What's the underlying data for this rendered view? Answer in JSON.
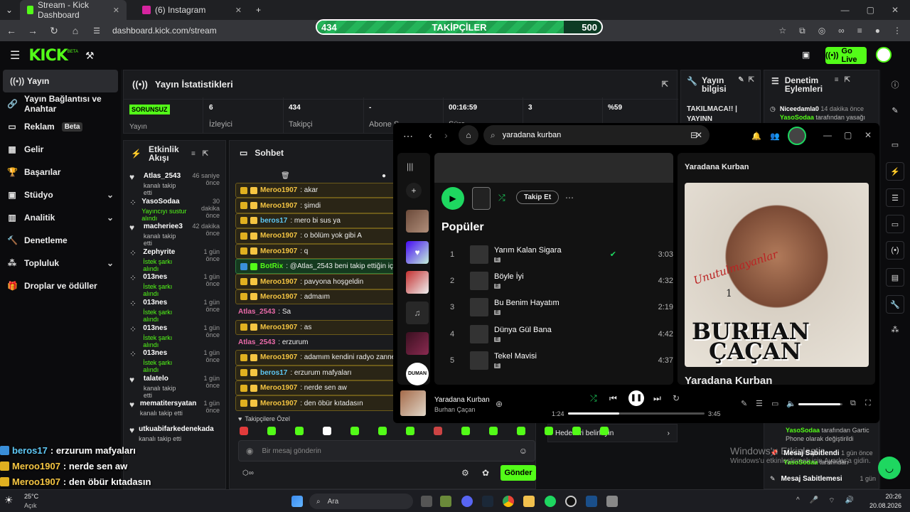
{
  "browser": {
    "tabs": [
      {
        "label": "Stream - Kick Dashboard",
        "color": "#53fc18"
      },
      {
        "label": "(6) Instagram",
        "color": "#d6249f"
      }
    ],
    "url": "dashboard.kick.com/stream",
    "follow_goal": {
      "label": "TAKİPÇİLER",
      "current": "434",
      "target": "500",
      "progress": 0.868
    }
  },
  "kick": {
    "logo": "KICK",
    "logo_sup": "BETA",
    "go_live": "Go Live",
    "nav": [
      {
        "label": "Yayın",
        "icon": "broadcast-icon",
        "active": true
      },
      {
        "label": "Yayın Bağlantısı ve Anahtar",
        "icon": "link-icon"
      },
      {
        "label": "Reklam",
        "icon": "ad-icon",
        "badge": "Beta"
      },
      {
        "label": "Gelir",
        "icon": "revenue-icon"
      },
      {
        "label": "Başarılar",
        "icon": "trophy-icon"
      },
      {
        "label": "Stüdyo",
        "icon": "studio-icon",
        "chevron": true
      },
      {
        "label": "Analitik",
        "icon": "chart-icon",
        "chevron": true
      },
      {
        "label": "Denetleme",
        "icon": "hammer-icon"
      },
      {
        "label": "Topluluk",
        "icon": "community-icon",
        "chevron": true
      },
      {
        "label": "Droplar ve ödüller",
        "icon": "gift-icon"
      }
    ]
  },
  "stats": {
    "title": "Yayın İstatistikleri",
    "status": "SORUNSUZ",
    "status_label": "Yayın",
    "items": [
      {
        "value": "6",
        "label": "İzleyici"
      },
      {
        "value": "434",
        "label": "Takipçi"
      },
      {
        "value": "-",
        "label": "Abone S"
      },
      {
        "value": "00:16:59",
        "label": "Süre"
      },
      {
        "value": "3",
        "label": ""
      },
      {
        "value": "%59",
        "label": ""
      }
    ]
  },
  "stream_info": {
    "title": "Yayın bilgisi",
    "text1": "TAKILMACA!! |",
    "text2": "YAYINN"
  },
  "mod": {
    "title": "Denetim Eylemleri",
    "top_user": "Niceedamla0",
    "top_time": "14 dakika önce",
    "top_sub1": "YasoSodaa",
    "top_sub2": " tarafından yasağı",
    "lines": [
      {
        "user": "YasoSodaa",
        "text": " tarafından Gartic Phone olarak değiştirildi"
      },
      {
        "title": "Mesaj Sabitlendi",
        "time": "1 gün önce",
        "user": "YasoSodaa",
        "text": " tarafından"
      },
      {
        "title": "Mesaj Sabitlemesi",
        "time": "1 gün"
      }
    ],
    "goal": "Hedefleri belirleyin"
  },
  "activity": {
    "title": "Etkinlik Akışı",
    "events": [
      {
        "name": "Atlas_2543",
        "sub": "kanalı takip etti",
        "time": "46 saniye önce",
        "icon": "heart-icon"
      },
      {
        "name": "YasoSodaa",
        "sub": "Yayıncıyı sustur alındı",
        "time": "30 dakika önce",
        "icon": "reward-icon",
        "green": true
      },
      {
        "name": "macheriee3",
        "sub": "kanalı takip etti",
        "time": "42 dakika önce",
        "icon": "heart-icon"
      },
      {
        "name": "Zephyrite",
        "sub": "İstek şarkı alındı",
        "time": "1 gün önce",
        "icon": "reward-icon",
        "green": true
      },
      {
        "name": "013nes",
        "sub": "İstek şarkı alındı",
        "time": "1 gün önce",
        "icon": "reward-icon",
        "green": true
      },
      {
        "name": "013nes",
        "sub": "İstek şarkı alındı",
        "time": "1 gün önce",
        "icon": "reward-icon",
        "green": true
      },
      {
        "name": "013nes",
        "sub": "İstek şarkı alındı",
        "time": "1 gün önce",
        "icon": "reward-icon",
        "green": true
      },
      {
        "name": "013nes",
        "sub": "İstek şarkı alındı",
        "time": "1 gün önce",
        "icon": "reward-icon",
        "green": true
      },
      {
        "name": "talatelo",
        "sub": "kanalı takip etti",
        "time": "1 gün önce",
        "icon": "heart-icon"
      },
      {
        "name": "mematitersyatan",
        "sub": "kanalı takip etti",
        "time": "1 gün önce",
        "icon": "heart-icon"
      },
      {
        "name": "utkuabifarkedenekada",
        "sub": "kanalı takip etti",
        "time": "",
        "icon": "heart-icon"
      }
    ]
  },
  "chat": {
    "title": "Sohbet",
    "messages": [
      {
        "user": "Meroo1907",
        "text": ": akar",
        "color": "#f5c542",
        "hl": true
      },
      {
        "user": "Meroo1907",
        "text": ": şimdi",
        "color": "#f5c542",
        "hl": true
      },
      {
        "user": "beros17",
        "text": ": mero bi sus ya",
        "color": "#5ec8f5",
        "hl": true
      },
      {
        "user": "Meroo1907",
        "text": ": o bölüm yok gibi A",
        "color": "#f5c542",
        "hl": true
      },
      {
        "user": "Meroo1907",
        "text": ": q",
        "color": "#f5c542",
        "hl": true
      },
      {
        "user": "BotRix",
        "text": ": @Atlas_2543 beni takip ettiğin için",
        "color": "#53fc18",
        "bot": true
      },
      {
        "user": "Meroo1907",
        "text": ": pavyona hoşgeldin",
        "color": "#f5c542",
        "hl": true
      },
      {
        "user": "Meroo1907",
        "text": ": admaım",
        "color": "#f5c542",
        "hl": true
      },
      {
        "user": "Atlas_2543",
        "text": ": Sa",
        "color": "#e86aa8"
      },
      {
        "user": "Meroo1907",
        "text": ": as",
        "color": "#f5c542",
        "hl": true
      },
      {
        "user": "Atlas_2543",
        "text": ": erzurum",
        "color": "#e86aa8"
      },
      {
        "user": "Meroo1907",
        "text": ": adamım kendini radyo zanned",
        "color": "#f5c542",
        "hl": true
      },
      {
        "user": "beros17",
        "text": ": erzurum mafyaları",
        "color": "#5ec8f5",
        "hl": true
      },
      {
        "user": "Meroo1907",
        "text": ": nerde sen aw",
        "color": "#f5c542",
        "hl": true
      },
      {
        "user": "Meroo1907",
        "text": ": den öbür kıtadasın",
        "color": "#f5c542",
        "hl": true
      }
    ],
    "followers_only": "Takipçilere Özel",
    "placeholder": "Bir mesaj gönderin",
    "send": "Gönder"
  },
  "spotify": {
    "search": "yaradana kurban",
    "follow": "Takip Et",
    "popular": "Popüler",
    "tracks": [
      {
        "n": "1",
        "title": "Yarım Kalan Sigara",
        "dur": "3:03",
        "liked": true
      },
      {
        "n": "2",
        "title": "Böyle İyi",
        "dur": "4:32"
      },
      {
        "n": "3",
        "title": "Bu Benim Hayatım",
        "dur": "2:19"
      },
      {
        "n": "4",
        "title": "Dünya Gül Bana",
        "dur": "4:42"
      },
      {
        "n": "5",
        "title": "Tekel Mavisi",
        "dur": "4:37"
      }
    ],
    "explicit": "E",
    "np_panel_title": "Yaradana Kurban",
    "np_panel_title2": "Yaradana Kurban",
    "album_art": {
      "line1": "Unutulmayanlar",
      "line2": "1",
      "line3": "BURHAN",
      "line4": "ÇAÇAN"
    },
    "now_playing": {
      "title": "Yaradana Kurban",
      "artist": "Burhan Çaçan",
      "elapsed": "1:24",
      "total": "3:45",
      "progress": 0.373,
      "volume": 0.95
    },
    "duman": "DUMAN"
  },
  "overlay_chat": [
    {
      "user": "beros17",
      "text": ": erzurum mafyaları",
      "color": "#5ec8f5"
    },
    {
      "user": "Meroo1907",
      "text": ": nerde sen aw",
      "color": "#f5c542"
    },
    {
      "user": "Meroo1907",
      "text": ": den öbür kıtadasın",
      "color": "#f5c542"
    }
  ],
  "windows": {
    "watermark1": "Windows'u Etkinleştir",
    "watermark2": "Windows'u etkinleştirmek için Ayarlar'a gidin.",
    "weather_temp": "25°C",
    "weather_desc": "Açık",
    "search": "Ara",
    "time": "20:26",
    "date": "20.08.2026"
  }
}
